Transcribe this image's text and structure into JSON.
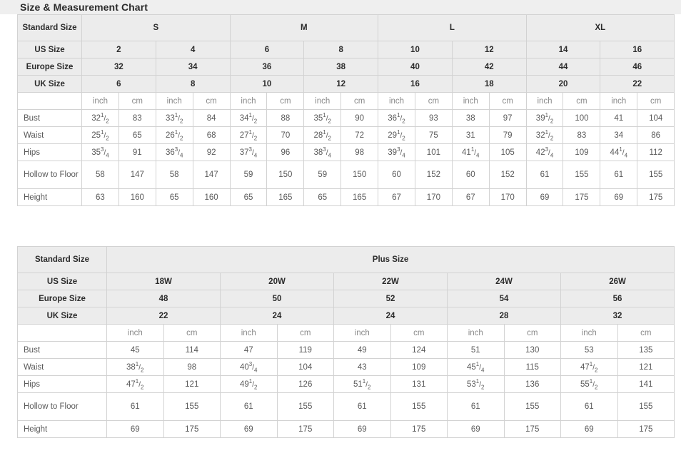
{
  "header": {
    "title": "Size & Measurement Chart"
  },
  "table1": {
    "name": "standard-size-table",
    "corner_label": "Standard Size",
    "groups": [
      {
        "label": "S",
        "span": 4
      },
      {
        "label": "M",
        "span": 4
      },
      {
        "label": "L",
        "span": 4
      },
      {
        "label": "XL",
        "span": 4
      }
    ],
    "size_rows": [
      {
        "label": "US Size",
        "values": [
          "2",
          "4",
          "6",
          "8",
          "10",
          "12",
          "14",
          "16"
        ]
      },
      {
        "label": "Europe Size",
        "values": [
          "32",
          "34",
          "36",
          "38",
          "40",
          "42",
          "44",
          "46"
        ]
      },
      {
        "label": "UK Size",
        "values": [
          "6",
          "8",
          "10",
          "12",
          "16",
          "18",
          "20",
          "22"
        ]
      }
    ],
    "unit_label_inch": "inch",
    "unit_label_cm": "cm",
    "unit_row_blank": "",
    "measure_rows": [
      {
        "label": "Bust",
        "cells": [
          {
            "whole": "32",
            "num": "1",
            "den": "2"
          },
          {
            "plain": "83"
          },
          {
            "whole": "33",
            "num": "1",
            "den": "2"
          },
          {
            "plain": "84"
          },
          {
            "whole": "34",
            "num": "1",
            "den": "2"
          },
          {
            "plain": "88"
          },
          {
            "whole": "35",
            "num": "1",
            "den": "2"
          },
          {
            "plain": "90"
          },
          {
            "whole": "36",
            "num": "1",
            "den": "2"
          },
          {
            "plain": "93"
          },
          {
            "plain": "38"
          },
          {
            "plain": "97"
          },
          {
            "whole": "39",
            "num": "1",
            "den": "2"
          },
          {
            "plain": "100"
          },
          {
            "plain": "41"
          },
          {
            "plain": "104"
          }
        ]
      },
      {
        "label": "Waist",
        "cells": [
          {
            "whole": "25",
            "num": "1",
            "den": "2"
          },
          {
            "plain": "65"
          },
          {
            "whole": "26",
            "num": "1",
            "den": "2"
          },
          {
            "plain": "68"
          },
          {
            "whole": "27",
            "num": "1",
            "den": "2"
          },
          {
            "plain": "70"
          },
          {
            "whole": "28",
            "num": "1",
            "den": "2"
          },
          {
            "plain": "72"
          },
          {
            "whole": "29",
            "num": "1",
            "den": "2"
          },
          {
            "plain": "75"
          },
          {
            "plain": "31"
          },
          {
            "plain": "79"
          },
          {
            "whole": "32",
            "num": "1",
            "den": "2"
          },
          {
            "plain": "83"
          },
          {
            "plain": "34"
          },
          {
            "plain": "86"
          }
        ]
      },
      {
        "label": "Hips",
        "cells": [
          {
            "whole": "35",
            "num": "3",
            "den": "4"
          },
          {
            "plain": "91"
          },
          {
            "whole": "36",
            "num": "3",
            "den": "4"
          },
          {
            "plain": "92"
          },
          {
            "whole": "37",
            "num": "3",
            "den": "4"
          },
          {
            "plain": "96"
          },
          {
            "whole": "38",
            "num": "3",
            "den": "4"
          },
          {
            "plain": "98"
          },
          {
            "whole": "39",
            "num": "3",
            "den": "4"
          },
          {
            "plain": "101"
          },
          {
            "whole": "41",
            "num": "1",
            "den": "4"
          },
          {
            "plain": "105"
          },
          {
            "whole": "42",
            "num": "3",
            "den": "4"
          },
          {
            "plain": "109"
          },
          {
            "whole": "44",
            "num": "1",
            "den": "4"
          },
          {
            "plain": "112"
          }
        ]
      },
      {
        "label": "Hollow to Floor",
        "tall": true,
        "cells": [
          {
            "plain": "58"
          },
          {
            "plain": "147"
          },
          {
            "plain": "58"
          },
          {
            "plain": "147"
          },
          {
            "plain": "59"
          },
          {
            "plain": "150"
          },
          {
            "plain": "59"
          },
          {
            "plain": "150"
          },
          {
            "plain": "60"
          },
          {
            "plain": "152"
          },
          {
            "plain": "60"
          },
          {
            "plain": "152"
          },
          {
            "plain": "61"
          },
          {
            "plain": "155"
          },
          {
            "plain": "61"
          },
          {
            "plain": "155"
          }
        ]
      },
      {
        "label": "Height",
        "cells": [
          {
            "plain": "63"
          },
          {
            "plain": "160"
          },
          {
            "plain": "65"
          },
          {
            "plain": "160"
          },
          {
            "plain": "65"
          },
          {
            "plain": "165"
          },
          {
            "plain": "65"
          },
          {
            "plain": "165"
          },
          {
            "plain": "67"
          },
          {
            "plain": "170"
          },
          {
            "plain": "67"
          },
          {
            "plain": "170"
          },
          {
            "plain": "69"
          },
          {
            "plain": "175"
          },
          {
            "plain": "69"
          },
          {
            "plain": "175"
          }
        ]
      }
    ]
  },
  "table2": {
    "name": "plus-size-table",
    "corner_label": "Standard Size",
    "group_label": "Plus Size",
    "size_rows": [
      {
        "label": "US Size",
        "values": [
          "18W",
          "20W",
          "22W",
          "24W",
          "26W"
        ]
      },
      {
        "label": "Europe Size",
        "values": [
          "48",
          "50",
          "52",
          "54",
          "56"
        ]
      },
      {
        "label": "UK Size",
        "values": [
          "22",
          "24",
          "24",
          "28",
          "32"
        ]
      }
    ],
    "unit_label_inch": "inch",
    "unit_label_cm": "cm",
    "unit_row_blank": "",
    "measure_rows": [
      {
        "label": "Bust",
        "cells": [
          {
            "plain": "45"
          },
          {
            "plain": "114"
          },
          {
            "plain": "47"
          },
          {
            "plain": "119"
          },
          {
            "plain": "49"
          },
          {
            "plain": "124"
          },
          {
            "plain": "51"
          },
          {
            "plain": "130"
          },
          {
            "plain": "53"
          },
          {
            "plain": "135"
          }
        ]
      },
      {
        "label": "Waist",
        "cells": [
          {
            "whole": "38",
            "num": "1",
            "den": "2"
          },
          {
            "plain": "98"
          },
          {
            "whole": "40",
            "num": "3",
            "den": "4"
          },
          {
            "plain": "104"
          },
          {
            "plain": "43"
          },
          {
            "plain": "109"
          },
          {
            "whole": "45",
            "num": "1",
            "den": "4"
          },
          {
            "plain": "115"
          },
          {
            "whole": "47",
            "num": "1",
            "den": "2"
          },
          {
            "plain": "121"
          }
        ]
      },
      {
        "label": "Hips",
        "cells": [
          {
            "whole": "47",
            "num": "1",
            "den": "2"
          },
          {
            "plain": "121"
          },
          {
            "whole": "49",
            "num": "1",
            "den": "2"
          },
          {
            "plain": "126"
          },
          {
            "whole": "51",
            "num": "1",
            "den": "2"
          },
          {
            "plain": "131"
          },
          {
            "whole": "53",
            "num": "1",
            "den": "2"
          },
          {
            "plain": "136"
          },
          {
            "whole": "55",
            "num": "1",
            "den": "2"
          },
          {
            "plain": "141"
          }
        ]
      },
      {
        "label": "Hollow to Floor",
        "tall": true,
        "cells": [
          {
            "plain": "61"
          },
          {
            "plain": "155"
          },
          {
            "plain": "61"
          },
          {
            "plain": "155"
          },
          {
            "plain": "61"
          },
          {
            "plain": "155"
          },
          {
            "plain": "61"
          },
          {
            "plain": "155"
          },
          {
            "plain": "61"
          },
          {
            "plain": "155"
          }
        ]
      },
      {
        "label": "Height",
        "cells": [
          {
            "plain": "69"
          },
          {
            "plain": "175"
          },
          {
            "plain": "69"
          },
          {
            "plain": "175"
          },
          {
            "plain": "69"
          },
          {
            "plain": "175"
          },
          {
            "plain": "69"
          },
          {
            "plain": "175"
          },
          {
            "plain": "69"
          },
          {
            "plain": "175"
          }
        ]
      }
    ]
  },
  "colors": {
    "header_bg": "#ececec",
    "title_band_bg": "#efefef",
    "border": "#d2d2d2",
    "text_dark": "#2b2b2b",
    "text_body": "#5a5a5a",
    "text_unit": "#8a8a8a"
  }
}
